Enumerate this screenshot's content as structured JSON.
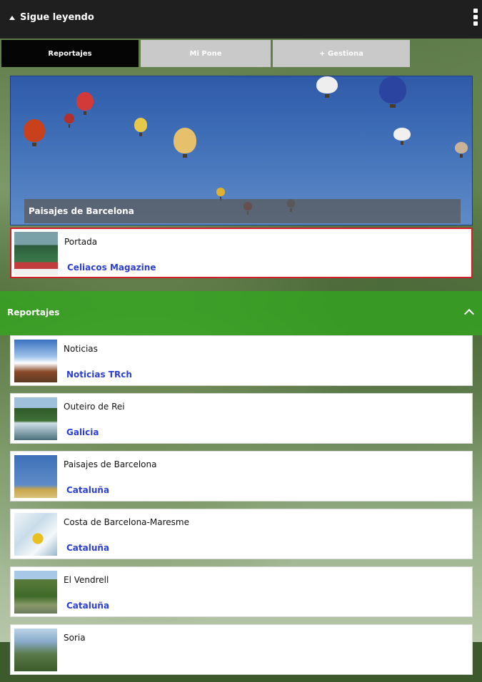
{
  "header": {
    "title": "Sigue leyendo"
  },
  "tabs": [
    {
      "label": "Reportajes"
    },
    {
      "label": "Mi Pone"
    },
    {
      "label": "+ Gestiona"
    }
  ],
  "hero": {
    "caption": "Paisajes de Barcelona"
  },
  "featured": {
    "title": "Portada",
    "subtitle": "Celiacos Magazine"
  },
  "section": {
    "title": "Reportajes"
  },
  "items": [
    {
      "title": "Noticias",
      "subtitle": "Noticias TRch",
      "thumb": "splash-photo"
    },
    {
      "title": "Outeiro de Rei",
      "subtitle": "Galicia",
      "thumb": "river-photo"
    },
    {
      "title": "Paisajes de Barcelona",
      "subtitle": "Cataluña",
      "thumb": "balloons-photo"
    },
    {
      "title": "Costa de Barcelona-Maresme",
      "subtitle": "Cataluña",
      "thumb": "kayak-photo"
    },
    {
      "title": "El Vendrell",
      "subtitle": "Cataluña",
      "thumb": "trees-photo"
    },
    {
      "title": "Soria",
      "subtitle": "",
      "thumb": "landscape-photo"
    }
  ],
  "colors": {
    "accent_link": "#2b3fd4",
    "featured_border": "#d41c2c",
    "topbar": "#1f1f1f"
  }
}
